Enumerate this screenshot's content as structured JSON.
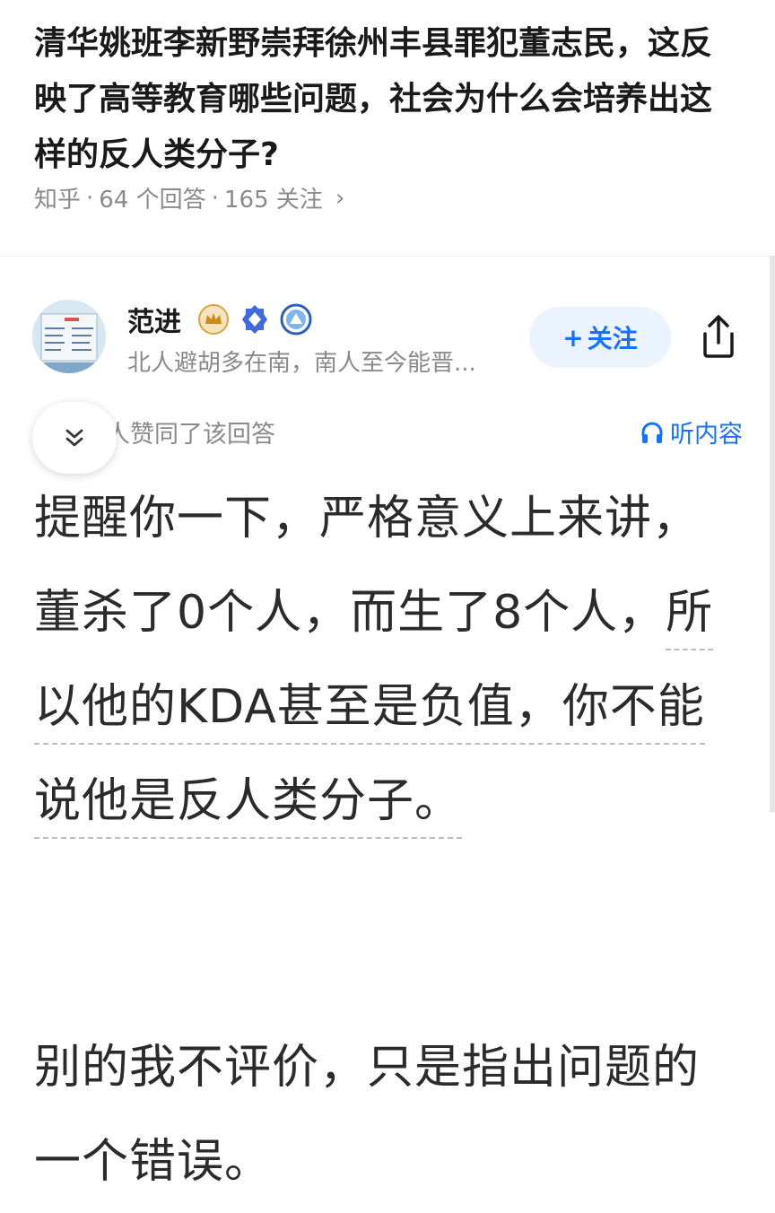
{
  "question": {
    "title": "清华姚班李新野崇拜徐州丰县罪犯董志民，这反映了高等教育哪些问题，社会为什么会培养出这样的反人类分子?",
    "source": "知乎",
    "answers_count": "64 个回答",
    "followers_count": "165 关注",
    "more_icon": "chevron-right-icon"
  },
  "author": {
    "name": "范进",
    "bio": "北人避胡多在南，南人至今能晋...",
    "badges": [
      "crown-badge-icon",
      "diamond-badge-icon",
      "triangle-badge-icon"
    ],
    "follow_label": "关注",
    "follow_icon": "plus-icon",
    "share_icon": "share-icon"
  },
  "answer_meta": {
    "upvote_text": "人赞同了该回答",
    "listen_label": "听内容",
    "listen_icon": "headphones-icon",
    "collapse_icon": "double-chevron-down-icon"
  },
  "answer": {
    "p1_part1": "提醒你一下，严格意义上来讲，董杀了0个人，而生了8个人，",
    "p1_part2": "所以他的KDA甚至是负值，你不能说他是反人类分子。",
    "p2": "别的我不评价，只是指出问题的一个错误。"
  },
  "colors": {
    "accent": "#1772f6",
    "follow_bg": "#ebf3fe",
    "muted_text": "#8a8a8a",
    "body_text": "#2b2b2b"
  }
}
